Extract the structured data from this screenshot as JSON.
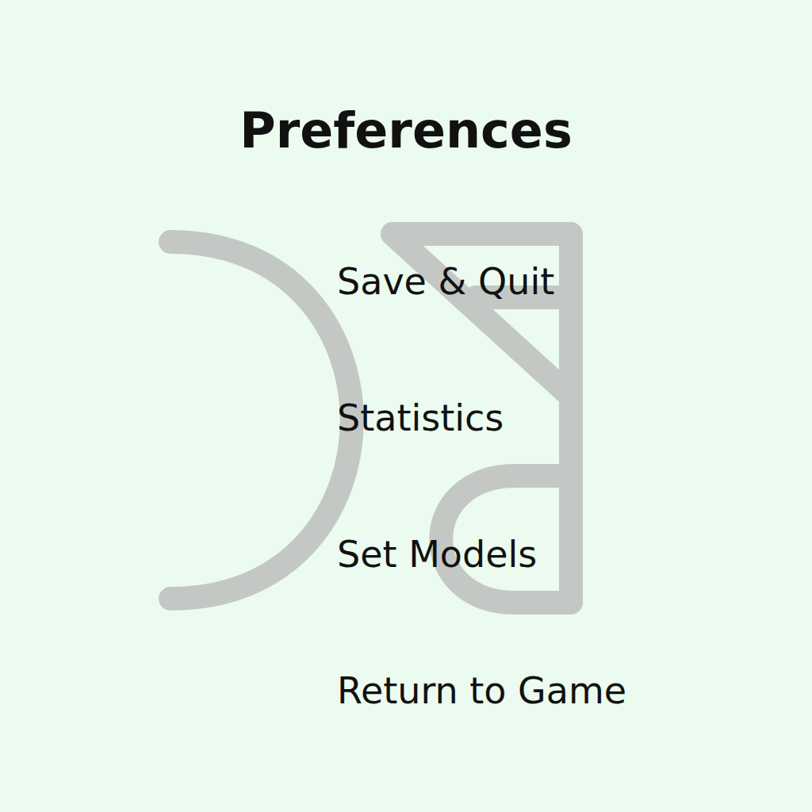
{
  "menu": {
    "title": "Preferences",
    "items": [
      {
        "label": "Save & Quit"
      },
      {
        "label": "Statistics"
      },
      {
        "label": "Set Models"
      },
      {
        "label": "Return to Game"
      }
    ]
  }
}
